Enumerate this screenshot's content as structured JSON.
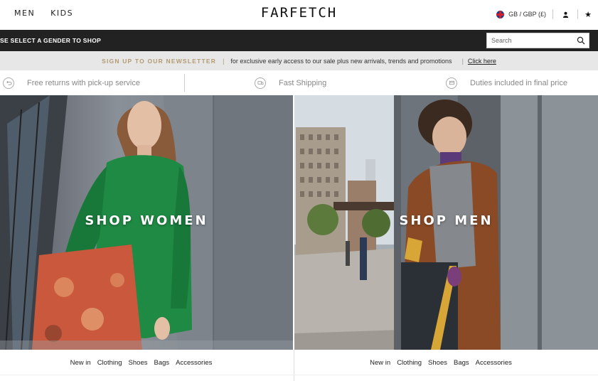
{
  "header": {
    "nav": [
      "MEN",
      "KIDS"
    ],
    "logo": "FARFETCH",
    "region": "GB / GBP (£)",
    "icons": {
      "account": "user-icon",
      "wishlist": "star-icon",
      "region_flag": "uk-flag-icon"
    }
  },
  "blackbar": {
    "gender_message": "SE SELECT A GENDER TO SHOP",
    "search": {
      "placeholder": "Search",
      "value": ""
    }
  },
  "newsletter": {
    "cta": "SIGN UP TO OUR NEWSLETTER",
    "pipe": "|",
    "text": "for exclusive early access to our sale plus new arrivals, trends and promotions",
    "link": "Click here"
  },
  "benefits": [
    {
      "label": "Free returns with pick-up service",
      "icon": "return-icon"
    },
    {
      "label": "Fast Shipping",
      "icon": "shipping-icon"
    },
    {
      "label": "Duties included in final price",
      "icon": "duties-icon"
    }
  ],
  "hero": {
    "women": {
      "label": "SHOP WOMEN",
      "links": [
        "New in",
        "Clothing",
        "Shoes",
        "Bags",
        "Accessories"
      ]
    },
    "men": {
      "label": "SHOP MEN",
      "links": [
        "New in",
        "Clothing",
        "Shoes",
        "Bags",
        "Accessories"
      ]
    }
  },
  "colors": {
    "black_bar": "#222222",
    "newsletter_bg": "#e7e7e7",
    "newsletter_accent": "#b39a72",
    "cardigan_green": "#1f8a44",
    "coat_brown": "#8a4a26"
  }
}
